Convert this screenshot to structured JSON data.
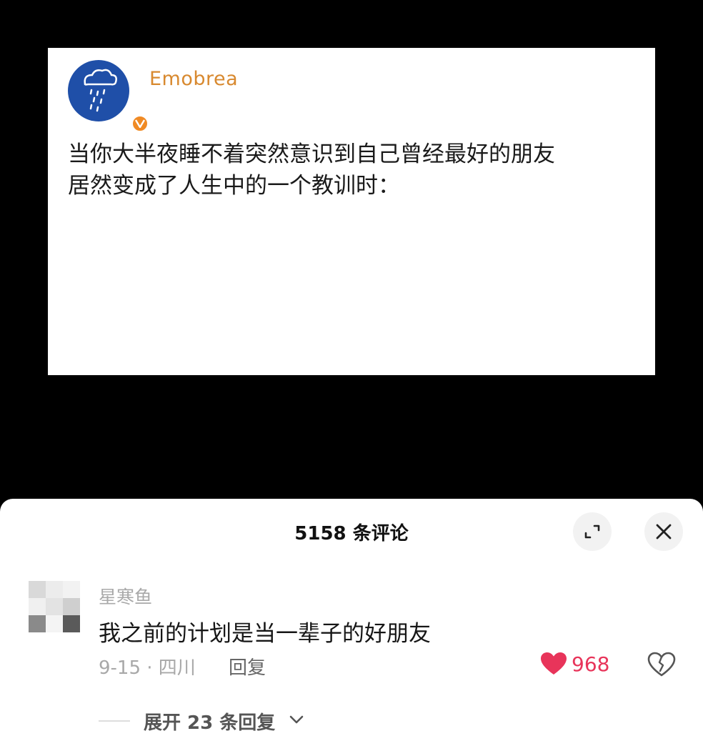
{
  "post": {
    "username": "Emobrea",
    "avatar_icon": "rain-cloud-icon",
    "badge_icon": "verified-badge-icon",
    "text_line1": "当你大半夜睡不着突然意识到自己曾经最好的朋友",
    "text_line2": "居然变成了人生中的一个教训时："
  },
  "sheet": {
    "title": "5158 条评论",
    "expand_icon": "expand-icon",
    "close_icon": "close-icon"
  },
  "comment": {
    "username": "星寒鱼",
    "text": "我之前的计划是当一辈子的好朋友",
    "meta": "9-15 · 四川",
    "reply_label": "回复",
    "like_count": "968",
    "like_icon": "heart-icon",
    "dislike_icon": "broken-heart-icon",
    "expand_replies_label": "展开 23 条回复"
  },
  "colors": {
    "background": "#000000",
    "username_orange": "#d8892f",
    "avatar_blue": "#1f4fa8",
    "like_red": "#e8345a"
  }
}
